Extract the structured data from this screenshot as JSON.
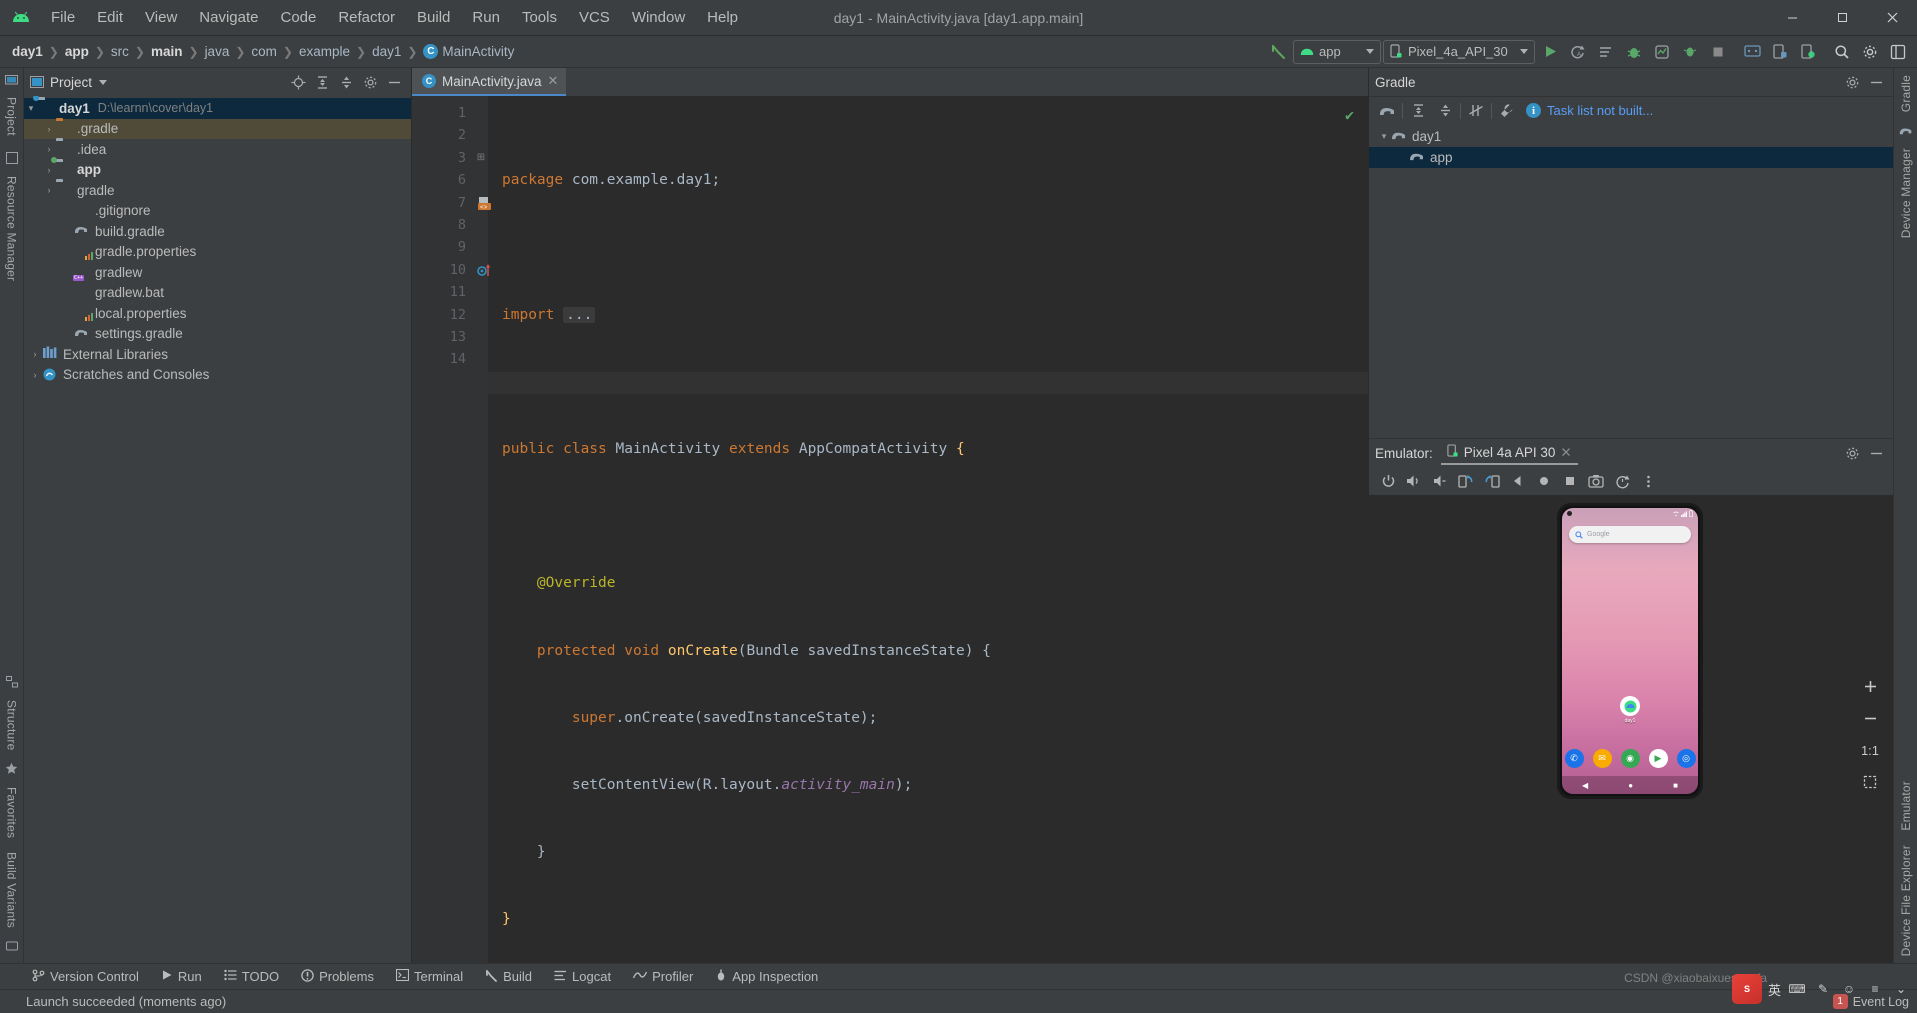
{
  "window": {
    "title": "day1 - MainActivity.java [day1.app.main]",
    "minimize": "—",
    "maximize": "▢",
    "close": "✕"
  },
  "menubar": {
    "logo": "android-logo",
    "items": [
      "File",
      "Edit",
      "View",
      "Navigate",
      "Code",
      "Refactor",
      "Build",
      "Run",
      "Tools",
      "VCS",
      "Window",
      "Help"
    ]
  },
  "breadcrumbs": [
    {
      "label": "day1",
      "bold": true
    },
    {
      "label": "app",
      "bold": true
    },
    {
      "label": "src",
      "bold": false
    },
    {
      "label": "main",
      "bold": true
    },
    {
      "label": "java",
      "bold": false
    },
    {
      "label": "com",
      "bold": false
    },
    {
      "label": "example",
      "bold": false
    },
    {
      "label": "day1",
      "bold": false
    },
    {
      "label": "MainActivity",
      "bold": false,
      "icon": "class-icon"
    }
  ],
  "toolbar": {
    "run_config": "app",
    "device": "Pixel_4a_API_30",
    "icons": [
      "run-icon",
      "rerun-icon",
      "apply-changes-icon",
      "debug-icon",
      "profile-icon",
      "attach-debugger-icon",
      "layout-inspector-icon",
      "stop-icon",
      "avd-manager-icon",
      "sdk-manager-icon",
      "device-file-explorer-icon",
      "search-icon",
      "settings-icon",
      "project-structure-icon"
    ]
  },
  "project_panel": {
    "title": "Project",
    "header_icons": [
      "locate-icon",
      "expand-all-icon",
      "collapse-all-icon",
      "settings-icon",
      "hide-icon"
    ],
    "tree": [
      {
        "label": "day1",
        "path": "D:\\learnn\\cover\\day1",
        "indent": 0,
        "twisty": "▾",
        "icon": "module-folder",
        "bold": true,
        "state": "selected"
      },
      {
        "label": ".gradle",
        "indent": 1,
        "twisty": "›",
        "icon": "folder-orange",
        "state": "highlight"
      },
      {
        "label": ".idea",
        "indent": 1,
        "twisty": "›",
        "icon": "folder-gray"
      },
      {
        "label": "app",
        "indent": 1,
        "twisty": "›",
        "icon": "module-folder",
        "bold": true
      },
      {
        "label": "gradle",
        "indent": 1,
        "twisty": "›",
        "icon": "folder-gray"
      },
      {
        "label": ".gitignore",
        "indent": 2,
        "icon": "gitignore-file"
      },
      {
        "label": "build.gradle",
        "indent": 2,
        "icon": "gradle-file"
      },
      {
        "label": "gradle.properties",
        "indent": 2,
        "icon": "properties-file"
      },
      {
        "label": "gradlew",
        "indent": 2,
        "icon": "script-file"
      },
      {
        "label": "gradlew.bat",
        "indent": 2,
        "icon": "text-file"
      },
      {
        "label": "local.properties",
        "indent": 2,
        "icon": "properties-file"
      },
      {
        "label": "settings.gradle",
        "indent": 2,
        "icon": "gradle-file"
      },
      {
        "label": "External Libraries",
        "indent": 0,
        "twisty": "›",
        "icon": "libraries-icon"
      },
      {
        "label": "Scratches and Consoles",
        "indent": 0,
        "twisty": "›",
        "icon": "scratches-icon"
      }
    ]
  },
  "editor": {
    "tab": {
      "label": "MainActivity.java",
      "icon": "class-icon",
      "close": "✕"
    },
    "inspection_status": "✔",
    "lines": [
      {
        "no": "1",
        "tokens": [
          {
            "t": "package ",
            "c": "kw"
          },
          {
            "t": "com.example.day1;",
            "c": ""
          }
        ]
      },
      {
        "no": "2",
        "tokens": []
      },
      {
        "no": "3",
        "tokens": [
          {
            "t": "import ",
            "c": "kw"
          },
          {
            "t": "...",
            "c": "fold"
          }
        ],
        "fold": "⊞"
      },
      {
        "no": "6",
        "tokens": []
      },
      {
        "no": "7",
        "tokens": [
          {
            "t": "public ",
            "c": "kw"
          },
          {
            "t": "class ",
            "c": "kw"
          },
          {
            "t": "MainActivity ",
            "c": ""
          },
          {
            "t": "extends ",
            "c": "kw"
          },
          {
            "t": "AppCompatActivity ",
            "c": ""
          },
          {
            "t": "{",
            "c": "brace"
          }
        ],
        "gutter_marker": "class-marker"
      },
      {
        "no": "8",
        "tokens": []
      },
      {
        "no": "9",
        "tokens": [
          {
            "t": "    @Override",
            "c": "annot"
          }
        ]
      },
      {
        "no": "10",
        "tokens": [
          {
            "t": "    protected ",
            "c": "kw"
          },
          {
            "t": "void ",
            "c": "kw"
          },
          {
            "t": "onCreate",
            "c": "fn"
          },
          {
            "t": "(Bundle savedInstanceState) {",
            "c": ""
          }
        ],
        "gutter_marker": "override-marker",
        "fold": "⊟"
      },
      {
        "no": "11",
        "tokens": [
          {
            "t": "        super",
            "c": "kw"
          },
          {
            "t": ".onCreate(savedInstanceState);",
            "c": ""
          }
        ]
      },
      {
        "no": "12",
        "tokens": [
          {
            "t": "        setContentView(R.layout.",
            "c": ""
          },
          {
            "t": "activity_main",
            "c": "field"
          },
          {
            "t": ");",
            "c": ""
          }
        ]
      },
      {
        "no": "13",
        "tokens": [
          {
            "t": "    }",
            "c": ""
          }
        ],
        "fold": "⊟"
      },
      {
        "no": "14",
        "tokens": [
          {
            "t": "}",
            "c": "brace"
          }
        ],
        "current": true
      }
    ]
  },
  "gradle_panel": {
    "title": "Gradle",
    "header_icons": [
      "settings-icon",
      "hide-icon"
    ],
    "toolbar_icons": [
      "gradle-elephant-icon",
      "expand-all-icon",
      "collapse-all-icon",
      "toggle-offline-icon",
      "wrench-icon"
    ],
    "task_note": "Task list not built...",
    "tree": [
      {
        "label": "day1",
        "indent": 0,
        "twisty": "▾",
        "icon": "gradle-elephant-icon"
      },
      {
        "label": "app",
        "indent": 1,
        "icon": "gradle-elephant-icon",
        "state": "selected"
      }
    ]
  },
  "emulator_panel": {
    "label": "Emulator:",
    "tab": {
      "label": "Pixel 4a API 30",
      "icon": "device-icon",
      "close": "✕"
    },
    "header_icons": [
      "settings-icon",
      "hide-icon"
    ],
    "toolbar_icons": [
      "power-icon",
      "volume-up-icon",
      "volume-down-icon",
      "rotate-left-icon",
      "rotate-right-icon",
      "back-icon",
      "home-icon",
      "overview-icon",
      "screenshot-icon",
      "snapshot-icon",
      "more-icon"
    ],
    "zoom_controls": [
      "zoom-in",
      "zoom-out",
      "zoom-actual",
      "zoom-fit"
    ],
    "zoom_actual_label": "1:1",
    "device_screen": {
      "search_placeholder": "Google",
      "app_label": "day1",
      "dock_apps": [
        "phone-icon",
        "messages-icon",
        "chrome-icon",
        "play-store-icon",
        "camera-icon"
      ],
      "nav": [
        "back-icon",
        "home-icon",
        "recents-icon"
      ]
    }
  },
  "left_rail": {
    "items": [
      "Project",
      "Resource Manager",
      "Structure",
      "Favorites",
      "Build Variants"
    ]
  },
  "right_rail": {
    "items": [
      "Gradle",
      "Device Manager",
      "Emulator",
      "Device File Explorer"
    ]
  },
  "tool_window_bar": [
    {
      "label": "Version Control",
      "icon": "branch-icon"
    },
    {
      "label": "Run",
      "icon": "run-icon"
    },
    {
      "label": "TODO",
      "icon": "todo-icon"
    },
    {
      "label": "Problems",
      "icon": "problems-icon"
    },
    {
      "label": "Terminal",
      "icon": "terminal-icon"
    },
    {
      "label": "Build",
      "icon": "build-icon"
    },
    {
      "label": "Logcat",
      "icon": "logcat-icon"
    },
    {
      "label": "Profiler",
      "icon": "profiler-icon"
    },
    {
      "label": "App Inspection",
      "icon": "app-inspection-icon"
    }
  ],
  "status_bar": {
    "message": "Launch succeeded (moments ago)",
    "event_log": "Event Log",
    "event_count": "1",
    "ime": {
      "logo": "sogou-logo",
      "lang": "英",
      "icons": [
        "keyboard-icon",
        "tools-icon",
        "emoji-icon",
        "settings-icon",
        "more-icon"
      ]
    },
    "watermark": "CSDN @xiaobaixuesuanfa"
  }
}
